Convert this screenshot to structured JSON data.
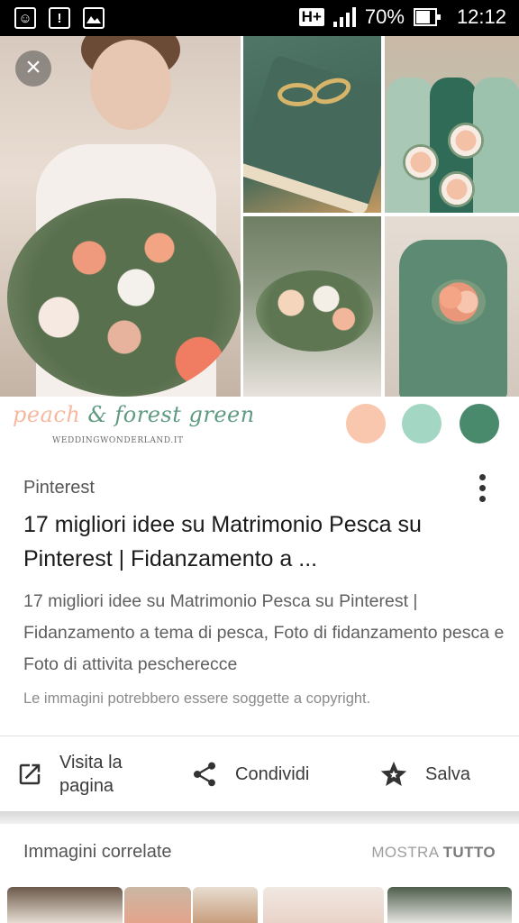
{
  "status_bar": {
    "network": "H+",
    "battery_text": "70%",
    "battery_level": 0.7,
    "time": "12:12",
    "icons": [
      "face-notification-icon",
      "alert-notification-icon",
      "image-notification-icon",
      "network-icon",
      "signal-icon",
      "battery-icon"
    ]
  },
  "image": {
    "close_icon": "close-icon",
    "palette": {
      "word1": "peach",
      "word2": "& forest green",
      "site": "WEDDINGWONDERLAND.IT",
      "swatches": [
        "#f8c7ad",
        "#a3d6c3",
        "#4a8a6c"
      ]
    }
  },
  "result": {
    "source": "Pinterest",
    "title": "17 migliori idee su Matrimonio Pesca su Pinterest | Fidanzamento a ...",
    "description": "17 migliori idee su Matrimonio Pesca su Pinterest | Fidanzamento a tema di pesca, Foto di fidanzamento pesca e Foto di attivita pescherecce",
    "copyright": "Le immagini potrebbero essere soggette a copyright."
  },
  "actions": {
    "visit_line1": "Visita la",
    "visit_line2": "pagina",
    "share": "Condividi",
    "save": "Salva"
  },
  "related": {
    "heading": "Immagini correlate",
    "show_all_1": "MOSTRA",
    "show_all_2": "TUTTO"
  }
}
